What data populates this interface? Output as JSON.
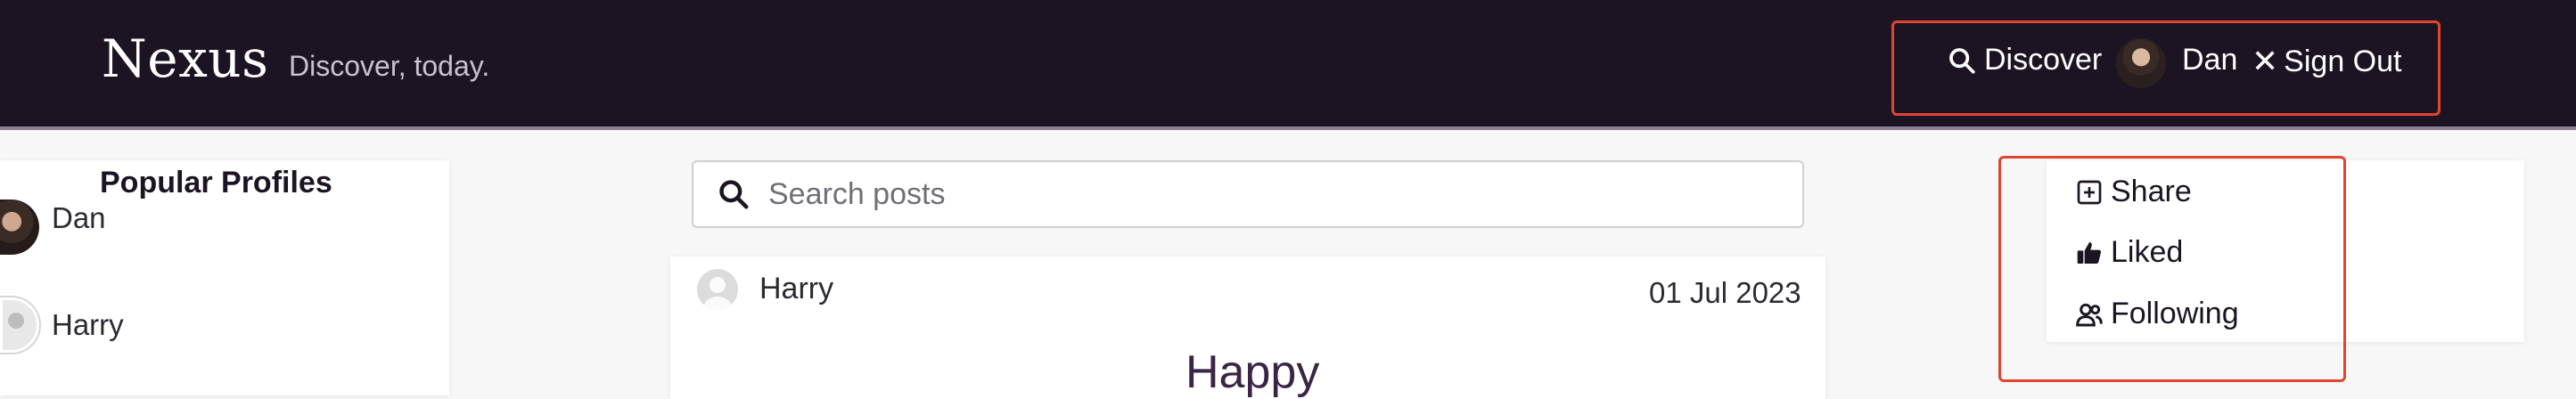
{
  "header": {
    "brand": "Nexus",
    "tagline": "Discover, today.",
    "nav": {
      "discover_label": "Discover",
      "user_name": "Dan",
      "signout_label": "Sign Out"
    }
  },
  "profiles": {
    "title": "Popular Profiles",
    "items": [
      {
        "name": "Dan",
        "avatar": "photo"
      },
      {
        "name": "Harry",
        "avatar": "default"
      }
    ]
  },
  "search": {
    "placeholder": "Search posts",
    "value": ""
  },
  "post": {
    "author": "Harry",
    "date": "01 Jul 2023",
    "body": "Happy"
  },
  "menu": {
    "items": [
      {
        "label": "Share",
        "icon": "plus-square-icon"
      },
      {
        "label": "Liked",
        "icon": "thumbs-up-icon"
      },
      {
        "label": "Following",
        "icon": "users-icon"
      }
    ]
  },
  "colors": {
    "header_bg": "#1d1423",
    "highlight": "#e0452e",
    "accent_text": "#3a2545"
  }
}
